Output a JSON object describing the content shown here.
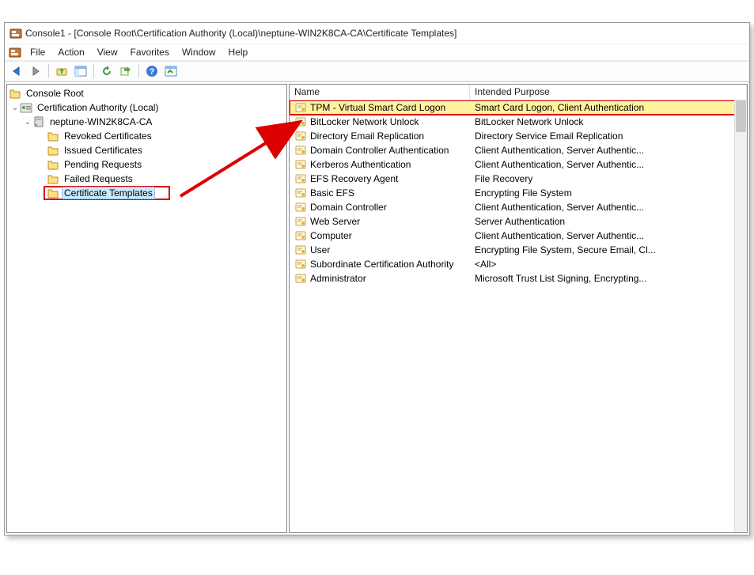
{
  "window": {
    "title": "Console1 - [Console Root\\Certification Authority (Local)\\neptune-WIN2K8CA-CA\\Certificate Templates]"
  },
  "menu": {
    "file": "File",
    "action": "Action",
    "view": "View",
    "favorites": "Favorites",
    "window": "Window",
    "help": "Help"
  },
  "tree": {
    "root": "Console Root",
    "ca": "Certification Authority (Local)",
    "server": "neptune-WIN2K8CA-CA",
    "nodes": {
      "revoked": "Revoked Certificates",
      "issued": "Issued Certificates",
      "pending": "Pending Requests",
      "failed": "Failed Requests",
      "templates": "Certificate Templates"
    }
  },
  "list": {
    "columns": {
      "name": "Name",
      "purpose": "Intended Purpose"
    },
    "rows": [
      {
        "name": "TPM - Virtual Smart Card Logon",
        "purpose": "Smart Card Logon, Client Authentication",
        "highlight": true
      },
      {
        "name": "BitLocker Network Unlock",
        "purpose": "BitLocker Network Unlock"
      },
      {
        "name": "Directory Email Replication",
        "purpose": "Directory Service Email Replication"
      },
      {
        "name": "Domain Controller Authentication",
        "purpose": "Client Authentication, Server Authentic..."
      },
      {
        "name": "Kerberos Authentication",
        "purpose": "Client Authentication, Server Authentic..."
      },
      {
        "name": "EFS Recovery Agent",
        "purpose": "File Recovery"
      },
      {
        "name": "Basic EFS",
        "purpose": "Encrypting File System"
      },
      {
        "name": "Domain Controller",
        "purpose": "Client Authentication, Server Authentic..."
      },
      {
        "name": "Web Server",
        "purpose": "Server Authentication"
      },
      {
        "name": "Computer",
        "purpose": "Client Authentication, Server Authentic..."
      },
      {
        "name": "User",
        "purpose": "Encrypting File System, Secure Email, Cl..."
      },
      {
        "name": "Subordinate Certification Authority",
        "purpose": "<All>"
      },
      {
        "name": "Administrator",
        "purpose": "Microsoft Trust List Signing, Encrypting..."
      }
    ]
  },
  "colors": {
    "highlight_bg": "#fff3a0",
    "annotation": "#d00000",
    "selection": "#cde8ff"
  }
}
